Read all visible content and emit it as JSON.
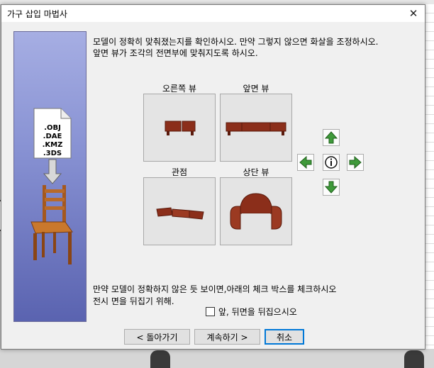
{
  "window": {
    "title": "가구 삽입 마법사",
    "close_glyph": "✕"
  },
  "sidebar": {
    "formats": [
      ".OBJ",
      ".DAE",
      ".KMZ",
      ".3DS"
    ]
  },
  "instructions": {
    "line1": "모델이 정확히 맞춰졌는지를 확인하시오. 만약 그렇지 않으면 화살을 조정하시오.",
    "line2": "앞면 뷰가 조각의 전면부에 맞춰지도록 하시오."
  },
  "views": {
    "right": "오른쪽 뷰",
    "front": "앞면 뷰",
    "perspective": "관점",
    "top": "상단 뷰"
  },
  "note": {
    "line1": "만약 모델이 정확하지 않은 듯 보이면,아래의 체크 박스를 체크하시오",
    "line2": "전시 면을 뒤집기 위해."
  },
  "checkbox": {
    "label": "앞, 뒤면을 뒤집으시오",
    "checked": false
  },
  "buttons": {
    "back": "< 돌아가기",
    "next": "계속하기 >",
    "cancel": "취소"
  },
  "icons": {
    "rotate_up": "arrow-up-icon",
    "rotate_left": "arrow-left-icon",
    "info": "info-icon",
    "rotate_right": "arrow-right-icon",
    "rotate_down": "arrow-down-icon"
  },
  "colors": {
    "furniture": "#8b2e1a",
    "arrow": "#3f9a3a",
    "accent": "#0078d7"
  }
}
